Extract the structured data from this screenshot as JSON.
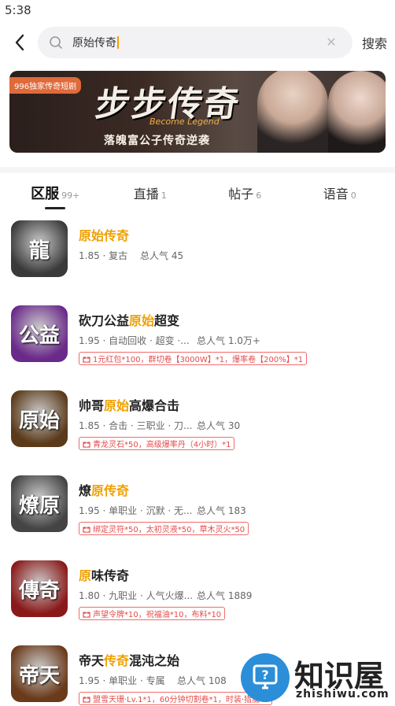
{
  "status": {
    "time": "5:38"
  },
  "search": {
    "value": "原始传奇",
    "button": "搜索"
  },
  "banner": {
    "tag": "996独家传奇短剧",
    "title": "步步传奇",
    "english": "Become Legend",
    "subtitle": "落魄富公子传奇逆袭"
  },
  "tabs": [
    {
      "label": "区服",
      "count": "99+"
    },
    {
      "label": "直播",
      "count": "1"
    },
    {
      "label": "帖子",
      "count": "6"
    },
    {
      "label": "语音",
      "count": "0"
    }
  ],
  "games": [
    {
      "title_parts": [
        "",
        "原始传奇",
        ""
      ],
      "tags": "1.85 · 复古",
      "popularity": "总人气 45",
      "gift": "",
      "thumb_text": "龍",
      "thumb_bg": "#3a3a3a"
    },
    {
      "title_parts": [
        "砍刀公益",
        "原始",
        "超变"
      ],
      "tags": "1.95 · 自动回收 · 超变 ·...",
      "popularity": "总人气 1.0万+",
      "gift": "1元红包*100，群切卷【3000W】*1，爆率卷【200%】*1",
      "thumb_text": "公益",
      "thumb_bg": "#6a2a8a"
    },
    {
      "title_parts": [
        "帅哥",
        "原始",
        "高爆合击"
      ],
      "tags": "1.85 · 合击 · 三职业 · 刀...",
      "popularity": "总人气 30",
      "gift": "青龙灵石*50，高级爆率丹（4小时）*1",
      "thumb_text": "原始",
      "thumb_bg": "#5a3a1a"
    },
    {
      "title_parts": [
        "燎",
        "原传奇",
        ""
      ],
      "tags": "1.95 · 单职业 · 沉默 · 无...",
      "popularity": "总人气 183",
      "gift": "绑定灵符*50，太初灵液*50，草木灵火*50",
      "thumb_text": "燎原",
      "thumb_bg": "#444444"
    },
    {
      "title_parts": [
        "",
        "原",
        "味传奇"
      ],
      "tags": "1.80 · 九职业 · 人气火爆...",
      "popularity": "总人气 1889",
      "gift": "声望令牌*10，祝福油*10，布料*10",
      "thumb_text": "傳奇",
      "thumb_bg": "#8a1a1a"
    },
    {
      "title_parts": [
        "帝天",
        "传奇",
        "混沌之始"
      ],
      "tags": "1.95 · 单职业 · 专属",
      "popularity": "总人气 108",
      "gift": "盟雪天珊·Lv.1*1，60分钟切割卷*1，时装·猎魔*1",
      "thumb_text": "帝天",
      "thumb_bg": "#6a3a1a"
    }
  ],
  "watermark": {
    "big": "知识屋",
    "small": "zhishiwu.com"
  }
}
